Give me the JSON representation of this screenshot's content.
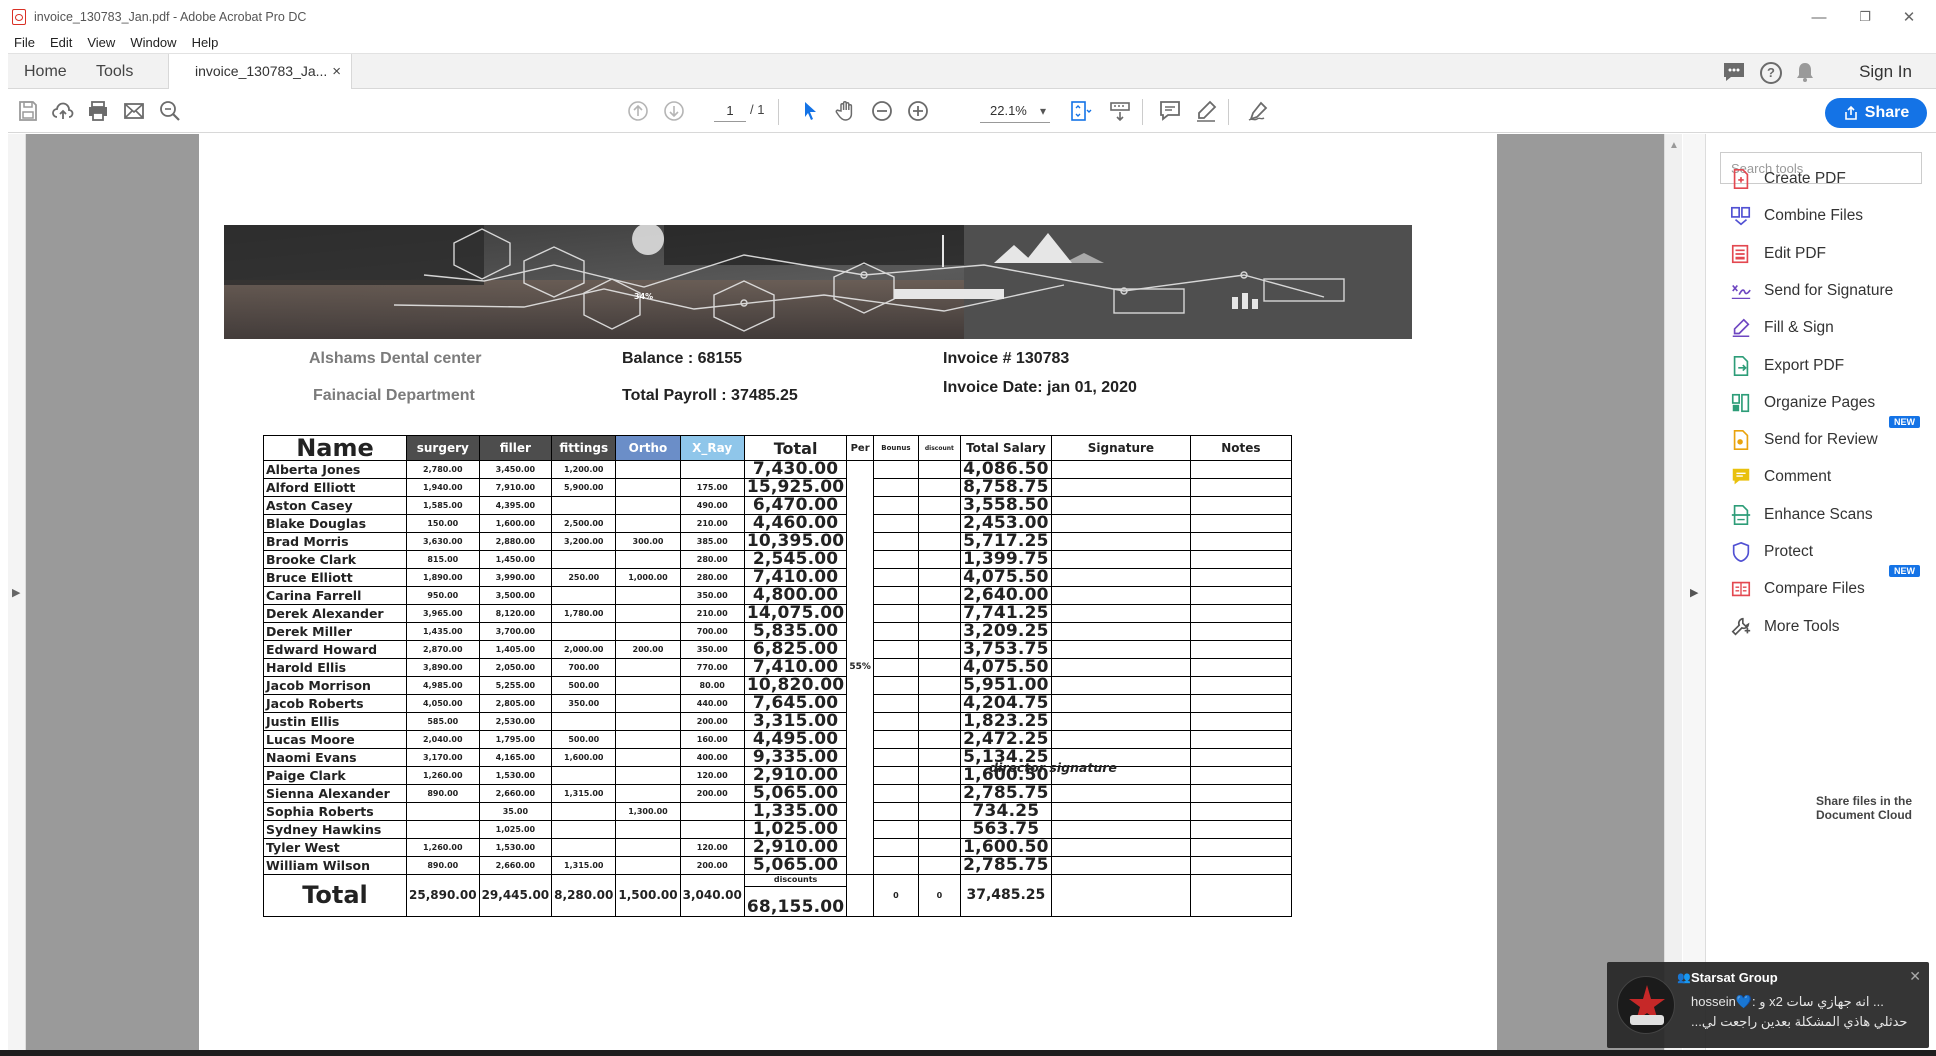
{
  "window": {
    "title": "invoice_130783_Jan.pdf - Adobe Acrobat Pro DC",
    "minimize": "—",
    "restore": "❐",
    "close": "✕"
  },
  "menu": [
    "File",
    "Edit",
    "View",
    "Window",
    "Help"
  ],
  "tabs": {
    "home": "Home",
    "tools": "Tools",
    "doc": "invoice_130783_Ja...",
    "doc_close": "×",
    "sign_in": "Sign In",
    "help": "?"
  },
  "toolbar": {
    "page_current": "1",
    "page_total": "/ 1",
    "zoom": "22.1%",
    "share": "Share"
  },
  "right_pane": {
    "search_placeholder": "Search tools",
    "tools": [
      {
        "label": "Create PDF",
        "icon": "create-pdf-icon",
        "color": "#e34850"
      },
      {
        "label": "Combine Files",
        "icon": "combine-files-icon",
        "color": "#5151d3"
      },
      {
        "label": "Edit PDF",
        "icon": "edit-pdf-icon",
        "color": "#e34850"
      },
      {
        "label": "Send for Signature",
        "icon": "send-signature-icon",
        "color": "#6e46c1"
      },
      {
        "label": "Fill & Sign",
        "icon": "fill-sign-icon",
        "color": "#6e46c1"
      },
      {
        "label": "Export PDF",
        "icon": "export-pdf-icon",
        "color": "#2d9d78"
      },
      {
        "label": "Organize Pages",
        "icon": "organize-pages-icon",
        "color": "#2d9d78"
      },
      {
        "label": "Send for Review",
        "icon": "send-review-icon",
        "color": "#e9a30d",
        "badge": "NEW"
      },
      {
        "label": "Comment",
        "icon": "comment-icon",
        "color": "#e9c10d"
      },
      {
        "label": "Enhance Scans",
        "icon": "enhance-scans-icon",
        "color": "#2d9d78"
      },
      {
        "label": "Protect",
        "icon": "protect-icon",
        "color": "#5151d3"
      },
      {
        "label": "Compare Files",
        "icon": "compare-files-icon",
        "color": "#e34850",
        "badge": "NEW"
      },
      {
        "label": "More Tools",
        "icon": "more-tools-icon",
        "color": "#555555"
      }
    ]
  },
  "notification": {
    "title": "Starsat Group",
    "line1": "hossein💙: و x2 انه جهازي سات ...",
    "line2": "...حدثلي هاذي المشكلة بعدين راجعت لي",
    "behind_text": "Share files in the Document Cloud"
  },
  "document": {
    "company": "Alshams Dental center",
    "department": "Fainacial Department",
    "balance": "Balance : 68155",
    "payroll": "Total Payroll : 37485.25",
    "invoice_no": "Invoice # 130783",
    "invoice_date": "Invoice Date: jan 01, 2020",
    "banner_pct": "34%",
    "headers": {
      "name": "Name",
      "surgery": "surgery",
      "filler": "filler",
      "fittings": "fittings",
      "ortho": "Ortho",
      "xray": "X_Ray",
      "total": "Total",
      "per": "Per",
      "bonus": "Bounus",
      "discount": "discount",
      "salary": "Total Salary",
      "signature": "Signature",
      "notes": "Notes"
    },
    "per_value": "55%",
    "rows": [
      {
        "name": "Alberta Jones",
        "surgery": "2,780.00",
        "filler": "3,450.00",
        "fittings": "1,200.00",
        "ortho": "",
        "xray": "",
        "total": "7,430.00",
        "salary": "4,086.50"
      },
      {
        "name": "Alford Elliott",
        "surgery": "1,940.00",
        "filler": "7,910.00",
        "fittings": "5,900.00",
        "ortho": "",
        "xray": "175.00",
        "total": "15,925.00",
        "salary": "8,758.75"
      },
      {
        "name": "Aston Casey",
        "surgery": "1,585.00",
        "filler": "4,395.00",
        "fittings": "",
        "ortho": "",
        "xray": "490.00",
        "total": "6,470.00",
        "salary": "3,558.50"
      },
      {
        "name": "Blake Douglas",
        "surgery": "150.00",
        "filler": "1,600.00",
        "fittings": "2,500.00",
        "ortho": "",
        "xray": "210.00",
        "total": "4,460.00",
        "salary": "2,453.00"
      },
      {
        "name": "Brad Morris",
        "surgery": "3,630.00",
        "filler": "2,880.00",
        "fittings": "3,200.00",
        "ortho": "300.00",
        "xray": "385.00",
        "total": "10,395.00",
        "salary": "5,717.25"
      },
      {
        "name": "Brooke Clark",
        "surgery": "815.00",
        "filler": "1,450.00",
        "fittings": "",
        "ortho": "",
        "xray": "280.00",
        "total": "2,545.00",
        "salary": "1,399.75"
      },
      {
        "name": "Bruce Elliott",
        "surgery": "1,890.00",
        "filler": "3,990.00",
        "fittings": "250.00",
        "ortho": "1,000.00",
        "xray": "280.00",
        "total": "7,410.00",
        "salary": "4,075.50"
      },
      {
        "name": "Carina Farrell",
        "surgery": "950.00",
        "filler": "3,500.00",
        "fittings": "",
        "ortho": "",
        "xray": "350.00",
        "total": "4,800.00",
        "salary": "2,640.00"
      },
      {
        "name": "Derek Alexander",
        "surgery": "3,965.00",
        "filler": "8,120.00",
        "fittings": "1,780.00",
        "ortho": "",
        "xray": "210.00",
        "total": "14,075.00",
        "salary": "7,741.25"
      },
      {
        "name": "Derek Miller",
        "surgery": "1,435.00",
        "filler": "3,700.00",
        "fittings": "",
        "ortho": "",
        "xray": "700.00",
        "total": "5,835.00",
        "salary": "3,209.25"
      },
      {
        "name": "Edward Howard",
        "surgery": "2,870.00",
        "filler": "1,405.00",
        "fittings": "2,000.00",
        "ortho": "200.00",
        "xray": "350.00",
        "total": "6,825.00",
        "salary": "3,753.75"
      },
      {
        "name": "Harold Ellis",
        "surgery": "3,890.00",
        "filler": "2,050.00",
        "fittings": "700.00",
        "ortho": "",
        "xray": "770.00",
        "total": "7,410.00",
        "salary": "4,075.50"
      },
      {
        "name": "Jacob Morrison",
        "surgery": "4,985.00",
        "filler": "5,255.00",
        "fittings": "500.00",
        "ortho": "",
        "xray": "80.00",
        "total": "10,820.00",
        "salary": "5,951.00"
      },
      {
        "name": "Jacob Roberts",
        "surgery": "4,050.00",
        "filler": "2,805.00",
        "fittings": "350.00",
        "ortho": "",
        "xray": "440.00",
        "total": "7,645.00",
        "salary": "4,204.75"
      },
      {
        "name": "Justin Ellis",
        "surgery": "585.00",
        "filler": "2,530.00",
        "fittings": "",
        "ortho": "",
        "xray": "200.00",
        "total": "3,315.00",
        "salary": "1,823.25"
      },
      {
        "name": "Lucas Moore",
        "surgery": "2,040.00",
        "filler": "1,795.00",
        "fittings": "500.00",
        "ortho": "",
        "xray": "160.00",
        "total": "4,495.00",
        "salary": "2,472.25"
      },
      {
        "name": "Naomi Evans",
        "surgery": "3,170.00",
        "filler": "4,165.00",
        "fittings": "1,600.00",
        "ortho": "",
        "xray": "400.00",
        "total": "9,335.00",
        "salary": "5,134.25"
      },
      {
        "name": "Paige Clark",
        "surgery": "1,260.00",
        "filler": "1,530.00",
        "fittings": "",
        "ortho": "",
        "xray": "120.00",
        "total": "2,910.00",
        "salary": "1,600.50"
      },
      {
        "name": "Sienna Alexander",
        "surgery": "890.00",
        "filler": "2,660.00",
        "fittings": "1,315.00",
        "ortho": "",
        "xray": "200.00",
        "total": "5,065.00",
        "salary": "2,785.75"
      },
      {
        "name": "Sophia Roberts",
        "surgery": "",
        "filler": "35.00",
        "fittings": "",
        "ortho": "1,300.00",
        "xray": "",
        "total": "1,335.00",
        "salary": "734.25"
      },
      {
        "name": "Sydney Hawkins",
        "surgery": "",
        "filler": "1,025.00",
        "fittings": "",
        "ortho": "",
        "xray": "",
        "total": "1,025.00",
        "salary": "563.75"
      },
      {
        "name": "Tyler West",
        "surgery": "1,260.00",
        "filler": "1,530.00",
        "fittings": "",
        "ortho": "",
        "xray": "120.00",
        "total": "2,910.00",
        "salary": "1,600.50"
      },
      {
        "name": "William Wilson",
        "surgery": "890.00",
        "filler": "2,660.00",
        "fittings": "1,315.00",
        "ortho": "",
        "xray": "200.00",
        "total": "5,065.00",
        "salary": "2,785.75"
      }
    ],
    "totals": {
      "label": "Total",
      "surgery": "25,890.00",
      "filler": "29,445.00",
      "fittings": "8,280.00",
      "ortho": "1,500.00",
      "xray": "3,040.00",
      "discounts_label": "discounts",
      "total": "68,155.00",
      "bonus": "0",
      "discount": "0",
      "salary": "37,485.25"
    },
    "director_signature": "director signature"
  }
}
